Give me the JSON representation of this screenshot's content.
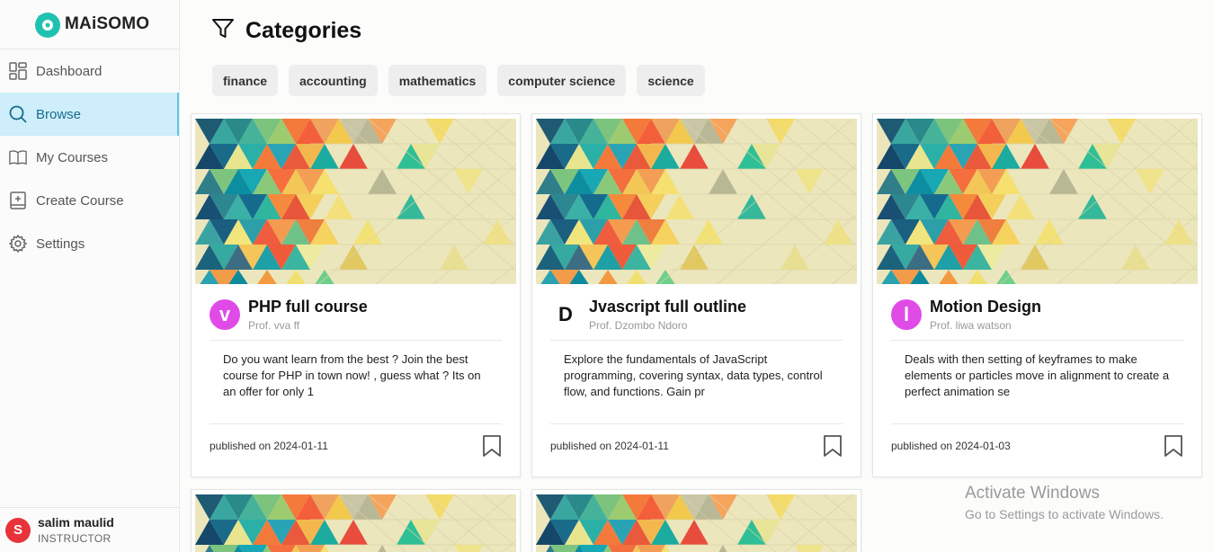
{
  "app": {
    "name": "MAiSOMO",
    "brand_color": "#1fc2b0"
  },
  "sidebar": {
    "items": [
      {
        "label": "Dashboard",
        "icon": "grid-icon",
        "active": false
      },
      {
        "label": "Browse",
        "icon": "search-icon",
        "active": true
      },
      {
        "label": "My Courses",
        "icon": "book-icon",
        "active": false
      },
      {
        "label": "Create Course",
        "icon": "add-book-icon",
        "active": false
      },
      {
        "label": "Settings",
        "icon": "gear-icon",
        "active": false
      }
    ],
    "user": {
      "initial": "S",
      "name": "salim maulid",
      "role": "INSTRUCTOR"
    }
  },
  "main": {
    "title": "Categories",
    "categories": [
      "finance",
      "accounting",
      "mathematics",
      "computer science",
      "science"
    ],
    "courses": [
      {
        "initial": "v",
        "title": "PHP full course",
        "author": "Prof. vva ff",
        "description": "Do you want learn from the best ? Join the best course for PHP in town now! , guess what ? Its on an offer for only 1",
        "published": "published on 2024-01-11"
      },
      {
        "initial": "D",
        "title": "Jvascript full outline",
        "author": "Prof. Dzombo Ndoro",
        "description": "Explore the fundamentals of JavaScript programming, covering syntax, data types, control flow, and functions. Gain pr",
        "published": "published on 2024-01-11"
      },
      {
        "initial": "l",
        "title": "Motion Design",
        "author": "Prof. liwa watson",
        "description": "Deals with then setting of keyframes to make elements or particles move in alignment to create a perfect animation se",
        "published": "published on 2024-01-03"
      }
    ]
  },
  "watermark": {
    "line1": "Activate Windows",
    "line2": "Go to Settings to activate Windows."
  }
}
